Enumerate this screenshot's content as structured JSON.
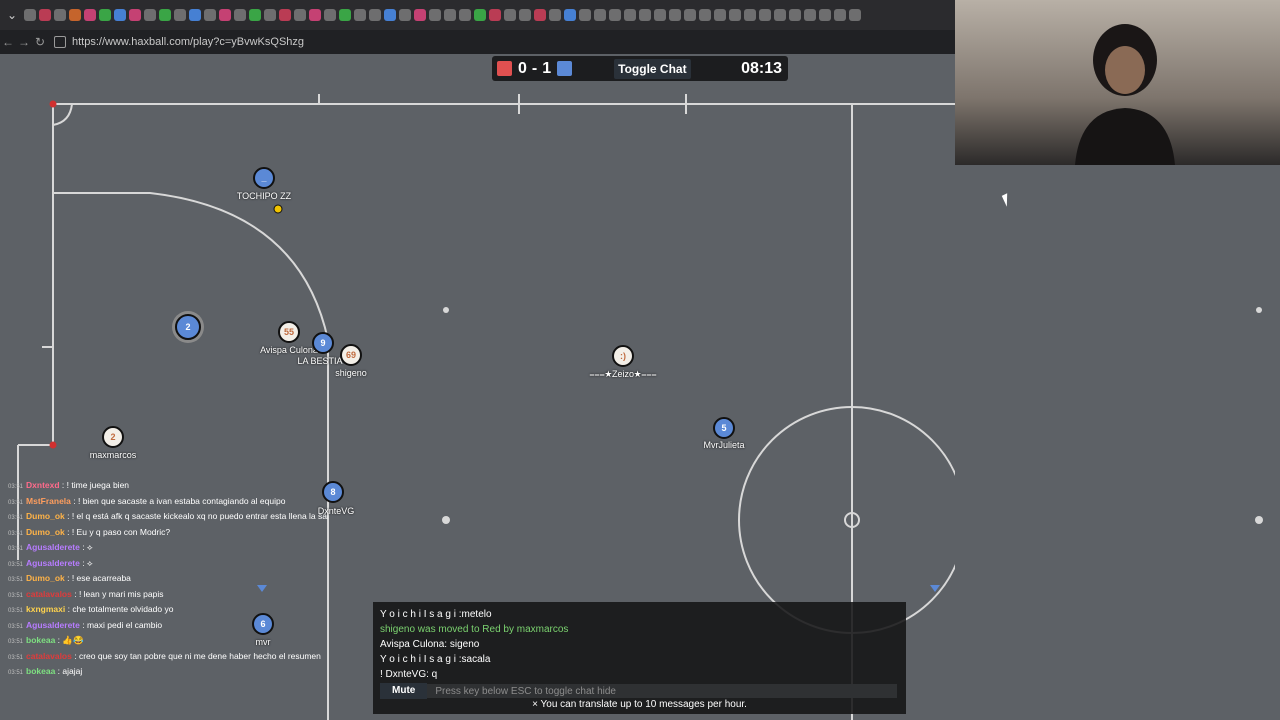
{
  "browser": {
    "url": "https://www.haxball.com/play?c=yBvwKsQShzg",
    "tab_icon_colors": [
      "#7a7a7a",
      "#d43f5a",
      "#7a7a7a",
      "#e06f2b",
      "#e0457f",
      "#3dbb4a",
      "#4b8ff0",
      "#e0457f",
      "#7a7a7a",
      "#3dbb4a",
      "#7a7a7a",
      "#4b8ff0",
      "#7a7a7a",
      "#e0457f",
      "#7a7a7a",
      "#3dbb4a",
      "#7a7a7a",
      "#d43f5a",
      "#7a7a7a",
      "#e0457f",
      "#7a7a7a",
      "#3dbb4a",
      "#7a7a7a",
      "#7a7a7a",
      "#4b8ff0",
      "#7a7a7a",
      "#e0457f",
      "#7a7a7a",
      "#7a7a7a",
      "#7a7a7a",
      "#3dbb4a",
      "#d43f5a",
      "#7a7a7a",
      "#7a7a7a",
      "#d43f5a",
      "#7a7a7a",
      "#4b8ff0",
      "#7a7a7a",
      "#7a7a7a",
      "#7a7a7a",
      "#7a7a7a",
      "#7a7a7a",
      "#7a7a7a",
      "#7a7a7a",
      "#7a7a7a",
      "#7a7a7a",
      "#7a7a7a",
      "#7a7a7a",
      "#7a7a7a",
      "#7a7a7a",
      "#7a7a7a",
      "#7a7a7a",
      "#7a7a7a",
      "#7a7a7a",
      "#7a7a7a",
      "#7a7a7a"
    ]
  },
  "scoreboard": {
    "red_score": "0",
    "separator": "-",
    "blue_score": "1",
    "toggle_chat_label": "Toggle Chat",
    "timer": "08:13",
    "red_color": "#e05050",
    "blue_color": "#5b89d6"
  },
  "players": {
    "tochipo": {
      "name": "TOCHIPO ZZ",
      "avatar": "_",
      "team": "blue"
    },
    "blue2": {
      "name": "",
      "avatar": "2",
      "team": "blue"
    },
    "avispa": {
      "name": "Avispa Culona",
      "avatar": "55",
      "team": "red"
    },
    "labestia": {
      "name": "LA BESTIA",
      "avatar": "9",
      "team": "blue"
    },
    "shigeno": {
      "name": "shigeno",
      "avatar": "69",
      "team": "red"
    },
    "zeizo": {
      "name": "⩶★Zeizo★⩶",
      "avatar": ":)",
      "team": "red"
    },
    "mvrjulieta": {
      "name": "MvrJulieta",
      "avatar": "5",
      "team": "blue"
    },
    "maxmarcos": {
      "name": "maxmarcos",
      "avatar": "2",
      "team": "red"
    },
    "dxntevg": {
      "name": "DxnteVG",
      "avatar": "8",
      "team": "blue"
    },
    "mvr": {
      "name": "mvr",
      "avatar": "6",
      "team": "blue"
    }
  },
  "stream_chat": [
    {
      "time": "03:51",
      "user": "Dxntexd",
      "user_color": "#ff6b8b",
      "text": ": ! time juega bien"
    },
    {
      "time": "03:51",
      "user": "MstFranela",
      "user_color": "#ff9e5e",
      "text": ": ! bien que sacaste a ivan estaba contagiando al equipo"
    },
    {
      "time": "03:51",
      "user": "Dumo_ok",
      "user_color": "#ffb347",
      "text": ": ! el q está afk q sacaste kickealo xq no puedo entrar esta llena la sala porfa"
    },
    {
      "time": "03:51",
      "user": "Dumo_ok",
      "user_color": "#ffb347",
      "text": ": ! Eu y q paso con Modric?"
    },
    {
      "time": "03:51",
      "user": "Agusalderete",
      "user_color": "#b77cff",
      "text": ": ⟡"
    },
    {
      "time": "03:51",
      "user": "Agusalderete",
      "user_color": "#b77cff",
      "text": ": ⟡"
    },
    {
      "time": "03:51",
      "user": "Dumo_ok",
      "user_color": "#ffb347",
      "text": ": ! ese acarreaba"
    },
    {
      "time": "03:51",
      "user": "catalavalos",
      "user_color": "#e03b3b",
      "text": ": ! lean y mari mis papis"
    },
    {
      "time": "03:51",
      "user": "kxngmaxi",
      "user_color": "#ffd34d",
      "text": ": che totalmente olvidado yo"
    },
    {
      "time": "03:51",
      "user": "Agusalderete",
      "user_color": "#b77cff",
      "text": ": maxi pedi el cambio"
    },
    {
      "time": "03:51",
      "user": "bokeaa",
      "user_color": "#7ee081",
      "text": ": 👍😂"
    },
    {
      "time": "03:51",
      "user": "catalavalos",
      "user_color": "#e03b3b",
      "text": ": creo que soy tan pobre que ni me dene haber hecho el resumen"
    },
    {
      "time": "03:51",
      "user": "bokeaa",
      "user_color": "#7ee081",
      "text": ": ajajaj"
    }
  ],
  "game_chat": {
    "messages": [
      {
        "text": "Y o i c h i  I s a g i :metelo",
        "type": "normal"
      },
      {
        "text": "shigeno was moved to Red by maxmarcos",
        "type": "system"
      },
      {
        "text": "Avispa Culona: sigeno",
        "type": "normal"
      },
      {
        "text": "Y o i c h i  I s a g i :sacala",
        "type": "normal"
      },
      {
        "text": "! DxnteVG: q",
        "type": "normal"
      }
    ],
    "mute_label": "Mute",
    "input_placeholder": "Press key below ESC to toggle chat hide",
    "notice": "× You can translate up to 10 messages per hour."
  }
}
